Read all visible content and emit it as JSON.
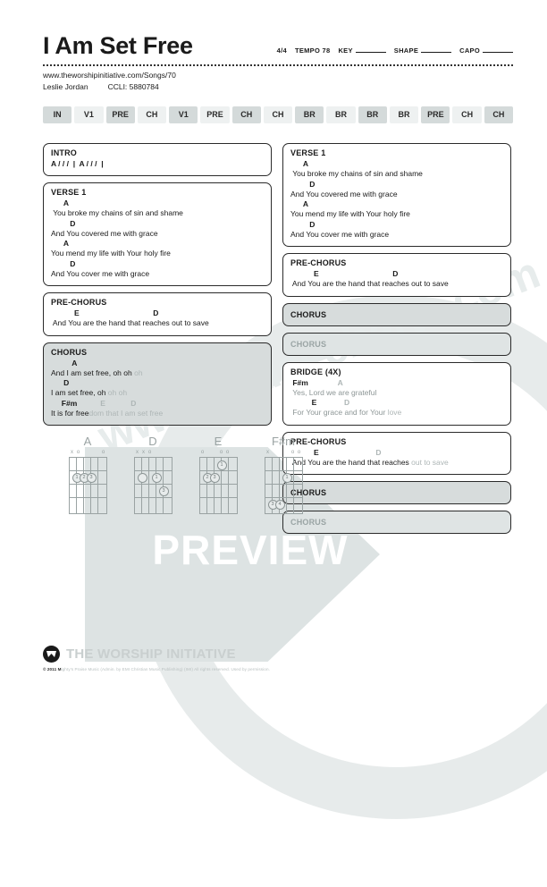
{
  "header": {
    "title": "I Am Set Free",
    "time_signature": "4/4",
    "tempo_label": "TEMPO 78",
    "key_label": "KEY",
    "shape_label": "SHAPE",
    "capo_label": "CAPO",
    "url": "www.theworshipinitiative.com/Songs/70",
    "author": "Leslie Jordan",
    "ccli": "CCLI: 5880784"
  },
  "flow": [
    {
      "label": "IN",
      "shade": "dark"
    },
    {
      "label": "V1",
      "shade": "light"
    },
    {
      "label": "PRE",
      "shade": "dark"
    },
    {
      "label": "CH",
      "shade": "light"
    },
    {
      "label": "V1",
      "shade": "dark"
    },
    {
      "label": "PRE",
      "shade": "light"
    },
    {
      "label": "CH",
      "shade": "dark"
    },
    {
      "label": "CH",
      "shade": "light"
    },
    {
      "label": "BR",
      "shade": "dark"
    },
    {
      "label": "BR",
      "shade": "light"
    },
    {
      "label": "BR",
      "shade": "dark"
    },
    {
      "label": "BR",
      "shade": "light"
    },
    {
      "label": "PRE",
      "shade": "dark"
    },
    {
      "label": "CH",
      "shade": "light"
    },
    {
      "label": "CH",
      "shade": "dark"
    }
  ],
  "left_column": {
    "intro": {
      "title": "INTRO",
      "bars": "A / / /  |  A / / /  |"
    },
    "verse1": {
      "title": "VERSE 1",
      "lines": [
        {
          "chords": "      A",
          "lyric": " You broke my chains of sin and shame"
        },
        {
          "chords": "         D",
          "lyric": "And You covered me with grace"
        },
        {
          "chords": "      A",
          "lyric": "You mend my life with Your holy fire"
        },
        {
          "chords": "         D",
          "lyric": "And You cover me with grace"
        }
      ]
    },
    "prechorus": {
      "title": "PRE-CHORUS",
      "lines": [
        {
          "chords": "           E                                   D",
          "lyric": " And You are the hand that reaches out to save"
        }
      ]
    },
    "chorus": {
      "title": "CHORUS",
      "lines": [
        {
          "chords": "          A",
          "lyric": "And I am set free, oh oh ",
          "lyric_faded": "oh"
        },
        {
          "chords": "      D",
          "lyric": "I am set free, oh ",
          "lyric_faded": "oh oh"
        },
        {
          "chords": "     F#m",
          "chords_faded": "           E            D",
          "lyric": "It is for free",
          "lyric_faded": "dom that I am set free"
        }
      ]
    }
  },
  "right_column": {
    "verse1": {
      "title": "VERSE 1",
      "lines": [
        {
          "chords": "      A",
          "lyric": " You broke my chains of sin and shame"
        },
        {
          "chords": "         D",
          "lyric": "And You covered me with grace"
        },
        {
          "chords": "      A",
          "lyric": "You mend my life with Your holy fire"
        },
        {
          "chords": "         D",
          "lyric": "And You cover me with grace"
        }
      ]
    },
    "prechorus1": {
      "title": "PRE-CHORUS",
      "lines": [
        {
          "chords": "           E                                   D",
          "lyric": " And You are the hand that reaches out to save"
        }
      ]
    },
    "chorus1": {
      "title": "CHORUS"
    },
    "chorus2": {
      "title": "CHORUS"
    },
    "bridge": {
      "title": "BRIDGE (4X)",
      "lines": [
        {
          "chords": " F#m",
          "chords_faded": "              A",
          "lyric": " Yes, Lord we are grateful"
        },
        {
          "chords": "          E",
          "chords_faded": "             D",
          "lyric": " For Your grace and for Your ",
          "lyric_faded": "love"
        }
      ]
    },
    "prechorus2": {
      "title": "PRE-CHORUS",
      "lines": [
        {
          "chords": "           E",
          "chords_faded": "                           D",
          "lyric": " And You are the hand that reaches ",
          "lyric_faded": "out to save"
        }
      ]
    },
    "chorus3": {
      "title": "CHORUS"
    },
    "chorus4": {
      "title": "CHORUS"
    }
  },
  "chord_diagrams": [
    {
      "name": "A",
      "markers": [
        "x",
        "o",
        "",
        "",
        "",
        "o"
      ]
    },
    {
      "name": "D",
      "markers": [
        "x",
        "x",
        "o",
        "",
        "",
        ""
      ]
    },
    {
      "name": "E",
      "markers": [
        "o",
        "",
        "",
        "o",
        "o",
        ""
      ]
    },
    {
      "name": "F#m",
      "markers": [
        "x",
        "",
        "",
        "",
        "o",
        "o"
      ]
    }
  ],
  "watermark": {
    "site_text": "www.praisecharts.com",
    "preview_text": "PREVIEW"
  },
  "footer": {
    "logo_text": "THE WORSHIP INITIATIVE",
    "copyright_prefix": "© 2011 M",
    "copyright_rest": "ighty's Praise Music (Admin. by EMI Christian Music Publishing) (IMI) All rights reserved.  Used by permission."
  }
}
